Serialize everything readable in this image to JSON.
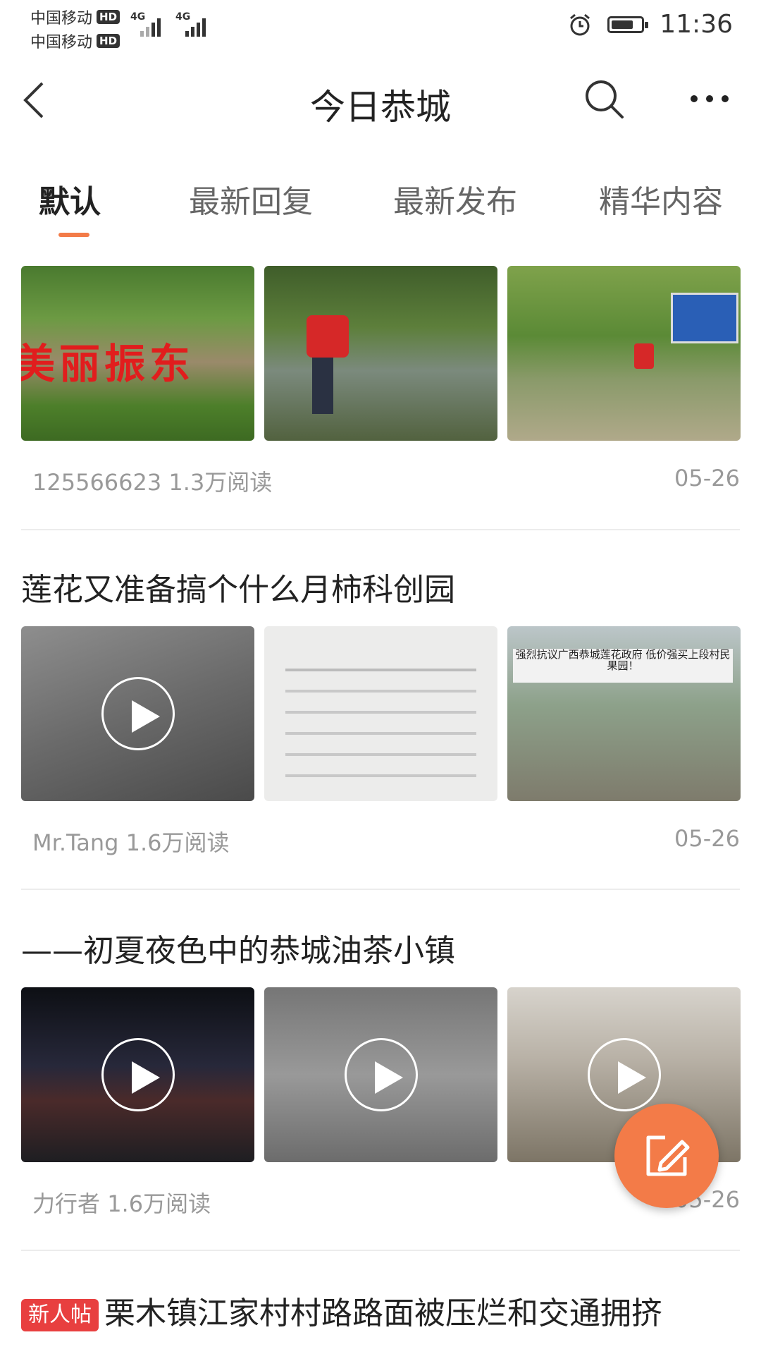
{
  "status_bar": {
    "carriers": [
      {
        "name": "中国移动",
        "hd": "HD"
      },
      {
        "name": "中国移动",
        "hd": "HD"
      }
    ],
    "network_labels": [
      "4G",
      "4G"
    ],
    "time": "11:36",
    "battery_level": 0.75
  },
  "nav": {
    "title": "今日恭城",
    "back_icon": "chevron-left-icon",
    "search_icon": "search-icon",
    "more_icon": "more-dots-icon"
  },
  "tabs": [
    {
      "label": "默认",
      "active": true
    },
    {
      "label": "最新回复",
      "active": false
    },
    {
      "label": "最新发布",
      "active": false
    },
    {
      "label": "精华内容",
      "active": false
    }
  ],
  "posts": [
    {
      "title": "",
      "images": [
        {
          "desc": "village landscape with red banner text",
          "overlay": "美丽振东",
          "video": false
        },
        {
          "desc": "volunteer in red vest digging by pond",
          "video": false
        },
        {
          "desc": "volunteer in red vest near blue sign",
          "video": false
        }
      ],
      "author": "125566623",
      "reads": "1.3万阅读",
      "date": "05-26"
    },
    {
      "title": "莲花又准备搞个什么月柿科创园",
      "images": [
        {
          "desc": "people standing on gravel",
          "video": true
        },
        {
          "desc": "printed notice document",
          "video": false
        },
        {
          "desc": "village street with protest banner",
          "overlay": "强烈抗议广西恭城莲花政府 低价强买上段村民果园！",
          "video": false
        }
      ],
      "author": "Mr.Tang",
      "reads": "1.6万阅读",
      "date": "05-26"
    },
    {
      "title": "——初夏夜色中的恭城油茶小镇",
      "images": [
        {
          "desc": "town street at night",
          "video": true
        },
        {
          "desc": "carved stone wall",
          "video": true
        },
        {
          "desc": "baskets with red characters",
          "video": true
        }
      ],
      "author": "力行者",
      "reads": "1.6万阅读",
      "date": "05-26"
    },
    {
      "badge": "新人帖",
      "title": "栗木镇江家村村路路面被压烂和交通拥挤"
    }
  ],
  "fab": {
    "icon": "edit-icon"
  },
  "colors": {
    "accent": "#f37b48",
    "badge": "#e83f3f"
  }
}
